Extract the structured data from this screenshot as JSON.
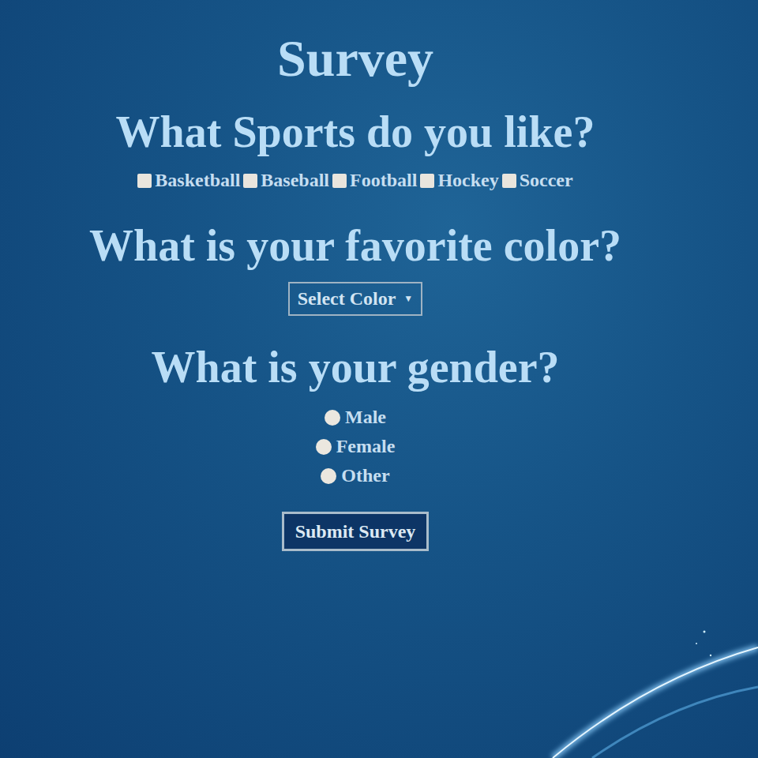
{
  "title": "Survey",
  "sports": {
    "question": "What Sports do you like?",
    "options": [
      {
        "label": "Basketball",
        "checked": false
      },
      {
        "label": "Baseball",
        "checked": false
      },
      {
        "label": "Football",
        "checked": false
      },
      {
        "label": "Hockey",
        "checked": false
      },
      {
        "label": "Soccer",
        "checked": false
      }
    ]
  },
  "color": {
    "question": "What is your favorite color?",
    "select": {
      "value": "Select Color",
      "caret": "▼"
    }
  },
  "gender": {
    "question": "What is your gender?",
    "options": [
      {
        "label": "Male",
        "selected": false
      },
      {
        "label": "Female",
        "selected": false
      },
      {
        "label": "Other",
        "selected": false
      }
    ]
  },
  "submit": "Submit Survey"
}
